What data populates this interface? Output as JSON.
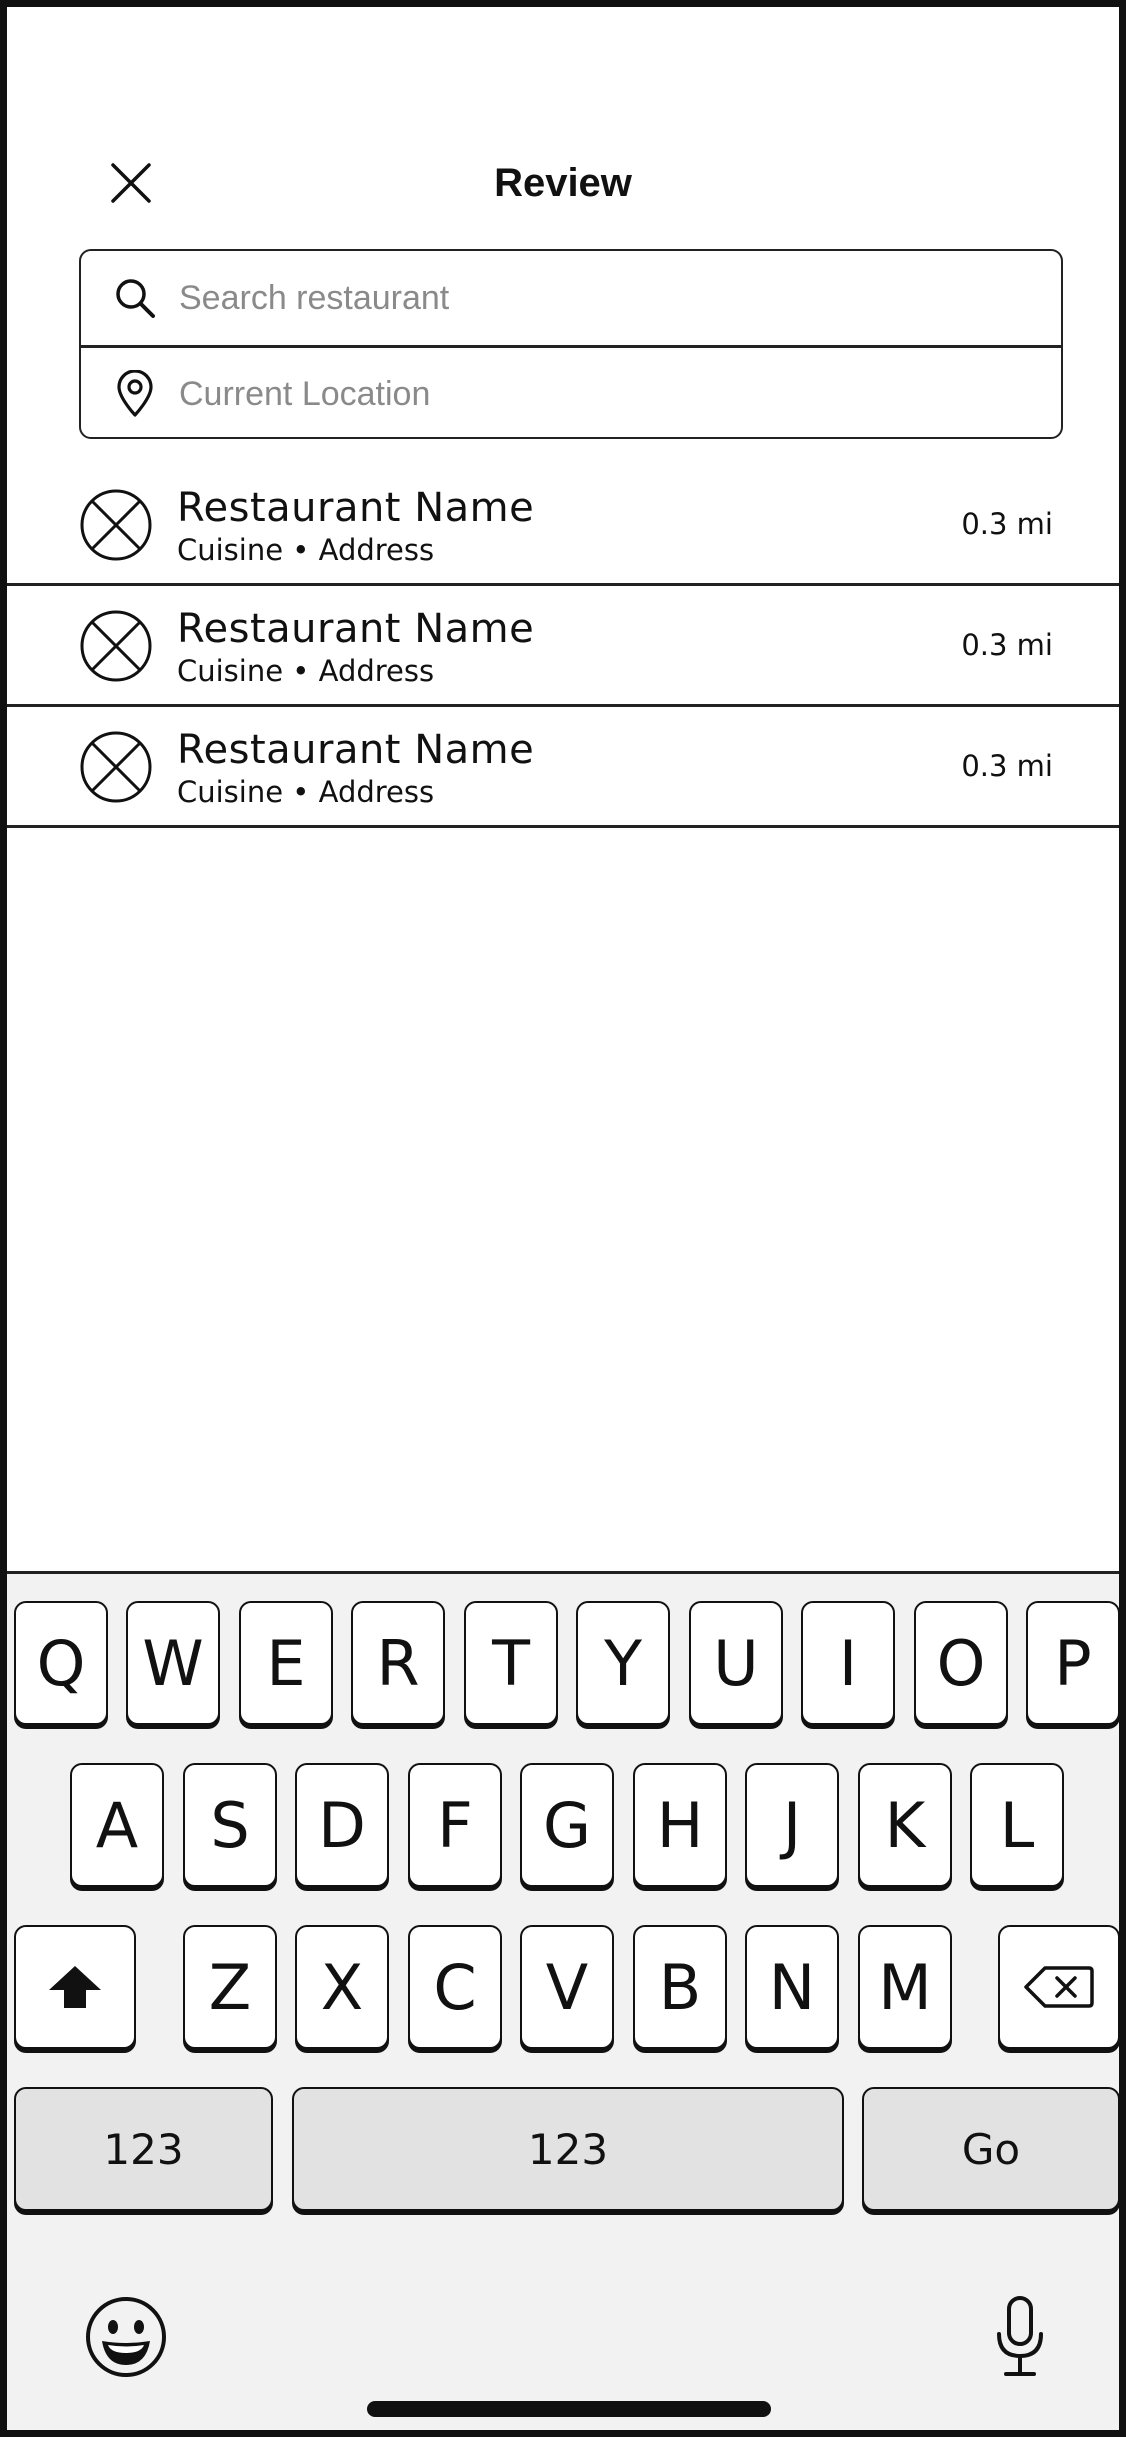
{
  "header": {
    "title": "Review",
    "close_icon": "close-icon"
  },
  "search": {
    "restaurant_placeholder": "Search restaurant",
    "restaurant_value": "",
    "location_placeholder": "Current Location",
    "location_value": "",
    "search_icon": "search-icon",
    "location_icon": "map-pin-icon"
  },
  "results": [
    {
      "name": "Restaurant Name",
      "subtitle": "Cuisine • Address",
      "distance": "0.3 mi"
    },
    {
      "name": "Restaurant Name",
      "subtitle": "Cuisine • Address",
      "distance": "0.3 mi"
    },
    {
      "name": "Restaurant Name",
      "subtitle": "Cuisine • Address",
      "distance": "0.3 mi"
    }
  ],
  "keyboard": {
    "row1": [
      "Q",
      "W",
      "E",
      "R",
      "T",
      "Y",
      "U",
      "I",
      "O",
      "P"
    ],
    "row2": [
      "A",
      "S",
      "D",
      "F",
      "G",
      "H",
      "J",
      "K",
      "L"
    ],
    "row3": [
      "Z",
      "X",
      "C",
      "V",
      "B",
      "N",
      "M"
    ],
    "numbers_label": "123",
    "space_label": "123",
    "go_label": "Go",
    "shift_icon": "shift-icon",
    "backspace_icon": "backspace-icon",
    "emoji_icon": "emoji-icon",
    "mic_icon": "microphone-icon"
  },
  "colors": {
    "border": "#111111",
    "placeholder": "#8a8a8a",
    "keyboard_bg": "#f2f2f2",
    "function_key_bg": "#e2e2e2"
  }
}
